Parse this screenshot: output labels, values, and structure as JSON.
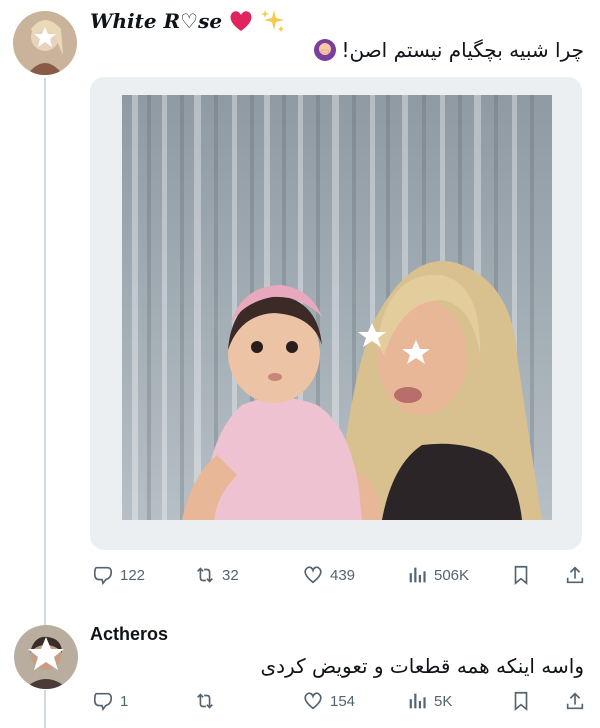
{
  "tweet1": {
    "author_name": "White R♡se",
    "text": "چرا شبیه بچگیام نیستم اصن!",
    "actions": {
      "replies": "122",
      "reposts": "32",
      "likes": "439",
      "views": "506K"
    }
  },
  "tweet2": {
    "author_name": "Actheros",
    "text": "واسه اینکه همه قطعات و تعویض کردی",
    "actions": {
      "replies": "1",
      "reposts": "",
      "likes": "154",
      "views": "5K"
    }
  },
  "icons": {
    "reply": "speech-bubble-icon",
    "repost": "repost-arrows-icon",
    "like": "heart-outline-icon",
    "views": "bar-chart-icon",
    "bookmark": "bookmark-icon",
    "share": "share-upload-icon"
  },
  "colors": {
    "action_gray": "#536471",
    "thread_line": "#cfd9de",
    "heart_red": "#e0245e"
  }
}
